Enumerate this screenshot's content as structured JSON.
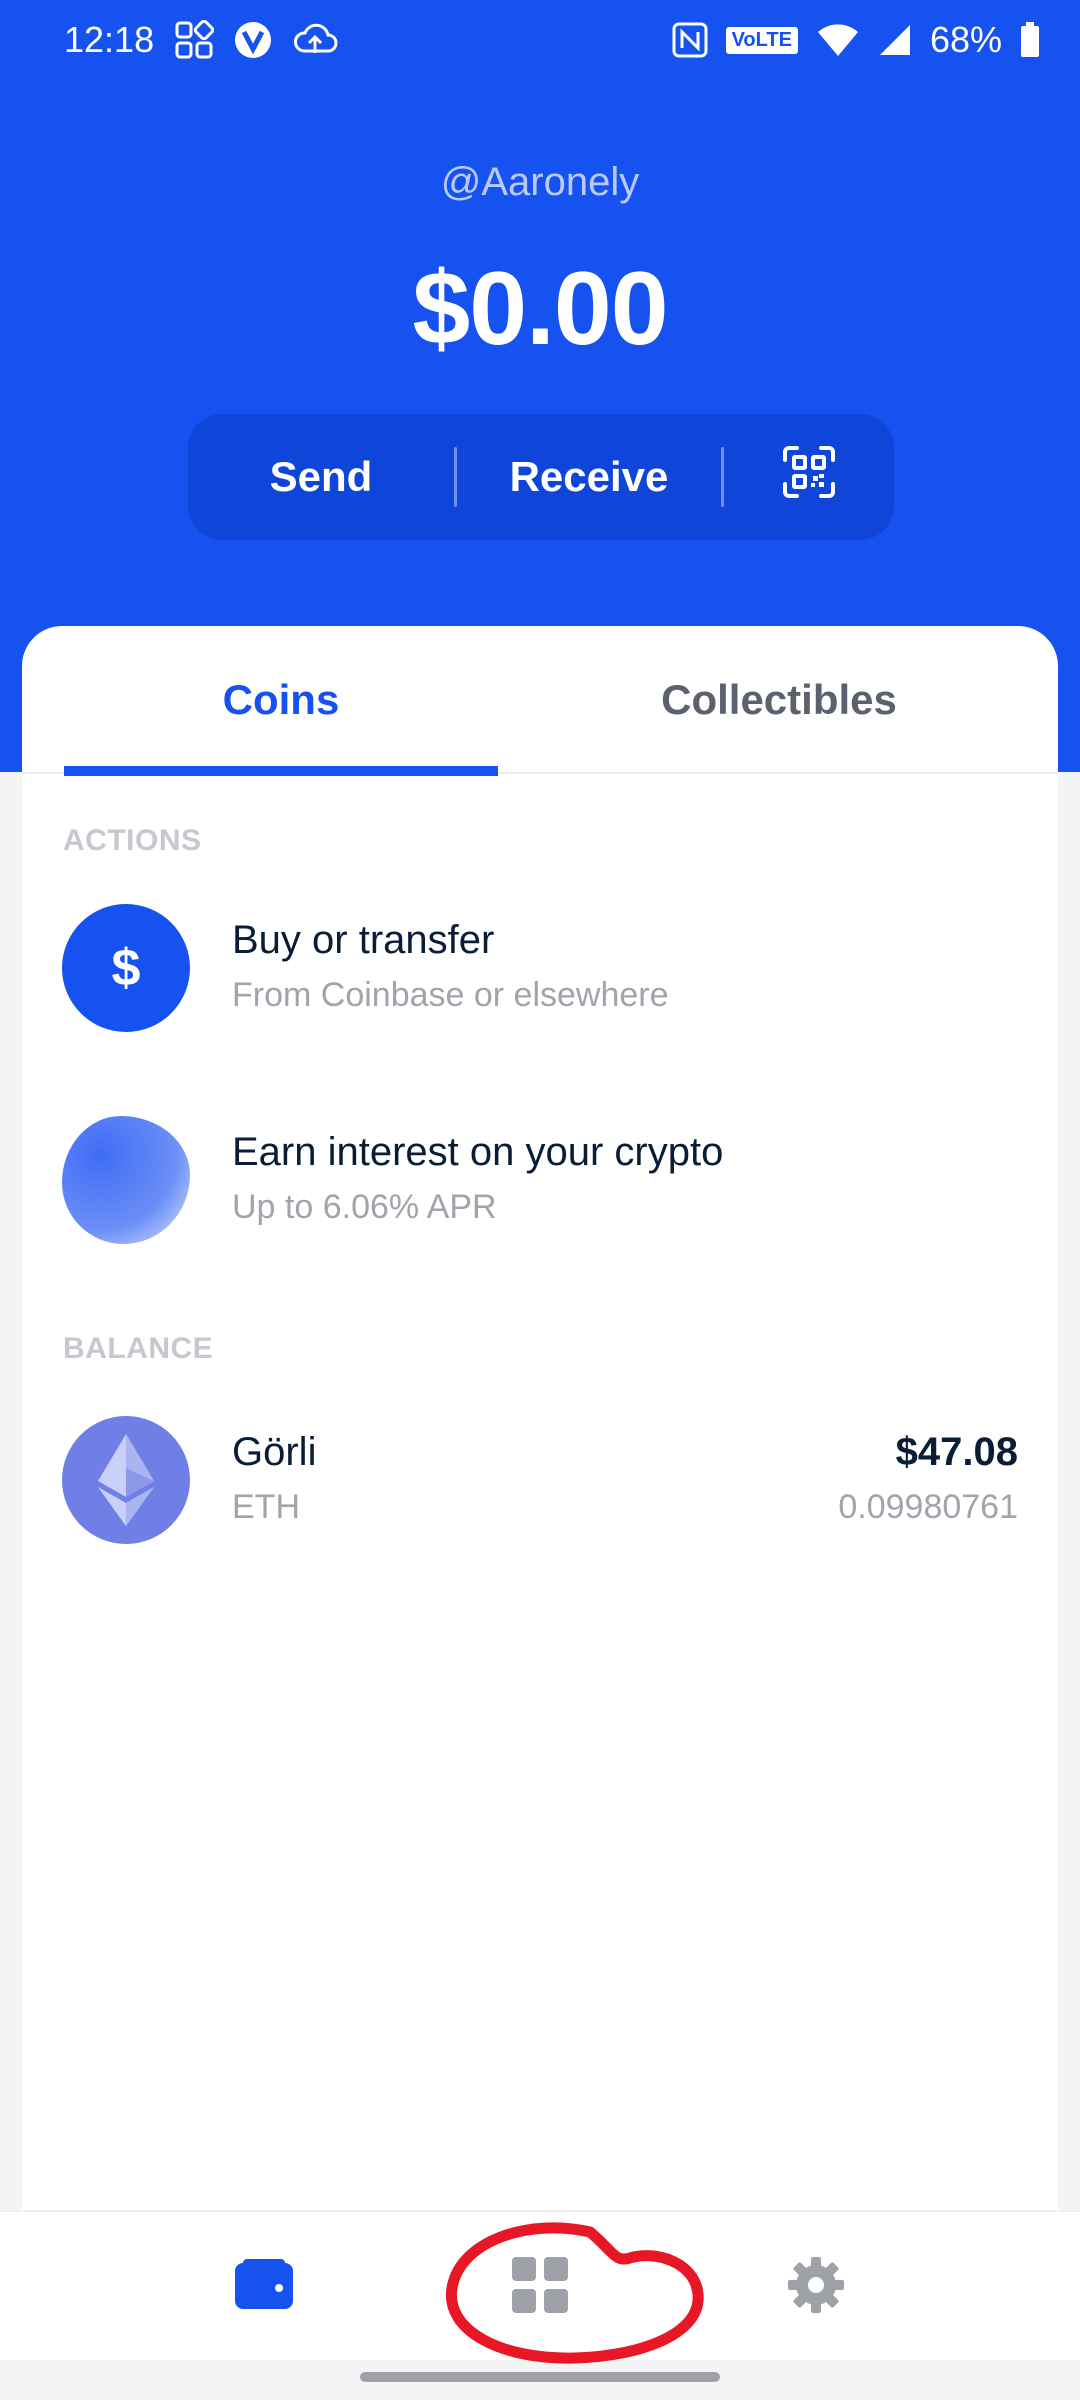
{
  "status_bar": {
    "time": "12:18",
    "volte_label": "VoLTE",
    "battery": "68%"
  },
  "header": {
    "username": "@Aaronely",
    "balance": "$0.00",
    "send_label": "Send",
    "receive_label": "Receive"
  },
  "tabs": {
    "coins_label": "Coins",
    "collectibles_label": "Collectibles"
  },
  "actions": {
    "section_label": "ACTIONS",
    "items": [
      {
        "title": "Buy or transfer",
        "subtitle": "From Coinbase or elsewhere",
        "icon_symbol": "$"
      },
      {
        "title": "Earn interest on your crypto",
        "subtitle": "Up to 6.06% APR"
      }
    ]
  },
  "balance_section": {
    "section_label": "BALANCE",
    "assets": [
      {
        "name": "Görli",
        "symbol": "ETH",
        "fiat_value": "$47.08",
        "amount": "0.09980761"
      }
    ]
  },
  "colors": {
    "brand": "#1652f0",
    "annotation": "#e81726"
  }
}
